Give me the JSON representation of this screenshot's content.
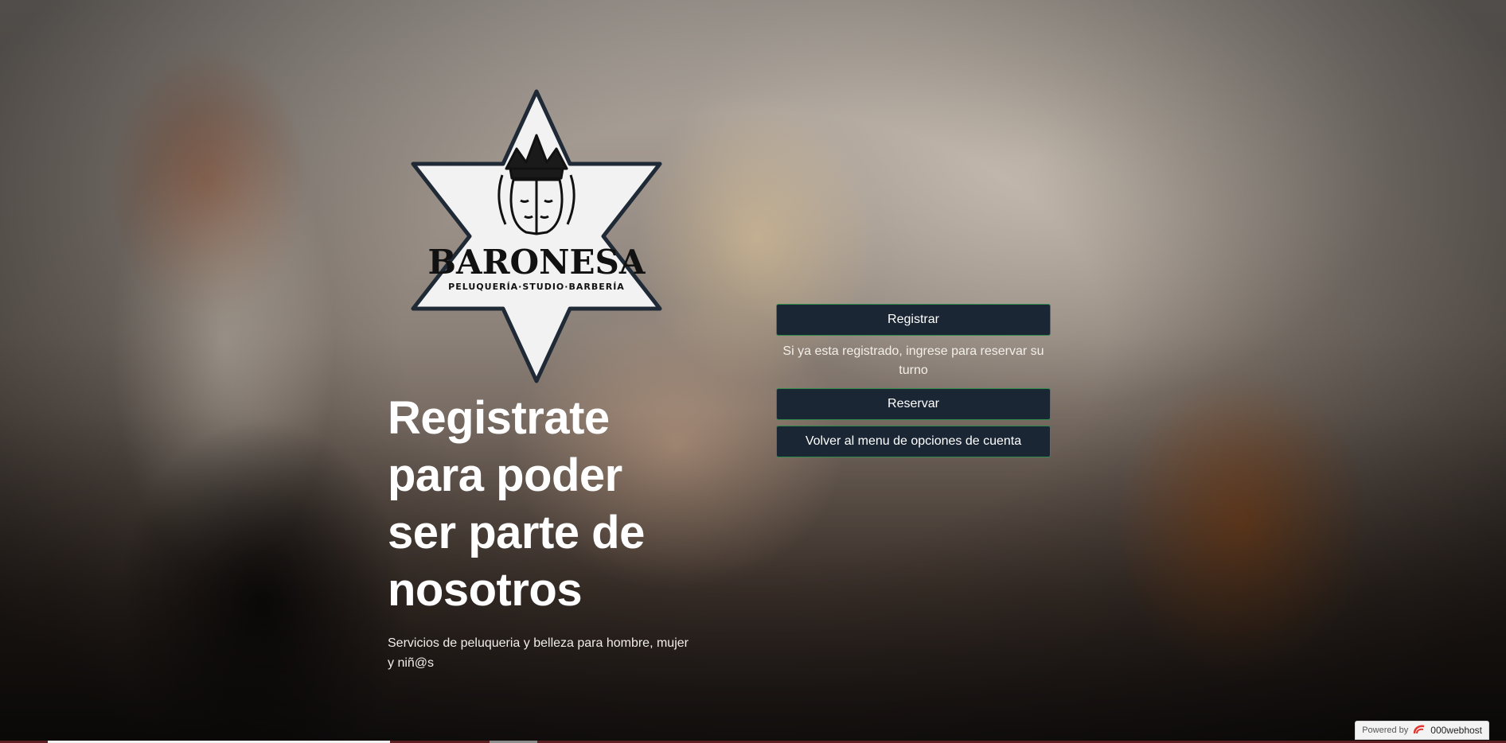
{
  "logo": {
    "name": "BARONESA",
    "tagline": "PELUQUERÍA·STUDIO·BARBERÍA"
  },
  "hero": {
    "title": "Registrate para poder ser parte de nosotros",
    "subtitle": "Servicios de peluqueria y belleza para hombre, mujer y niñ@s"
  },
  "actions": {
    "register_label": "Registrar",
    "note": "Si ya esta registrado, ingrese para reservar su turno",
    "reserve_label": "Reservar",
    "back_label": "Volver al menu de opciones de cuenta"
  },
  "footer": {
    "powered_by": "Powered by",
    "host": "000webhost"
  },
  "colors": {
    "button_bg": "#1b2634",
    "button_border": "#2f8a4b",
    "text": "#ffffff"
  }
}
